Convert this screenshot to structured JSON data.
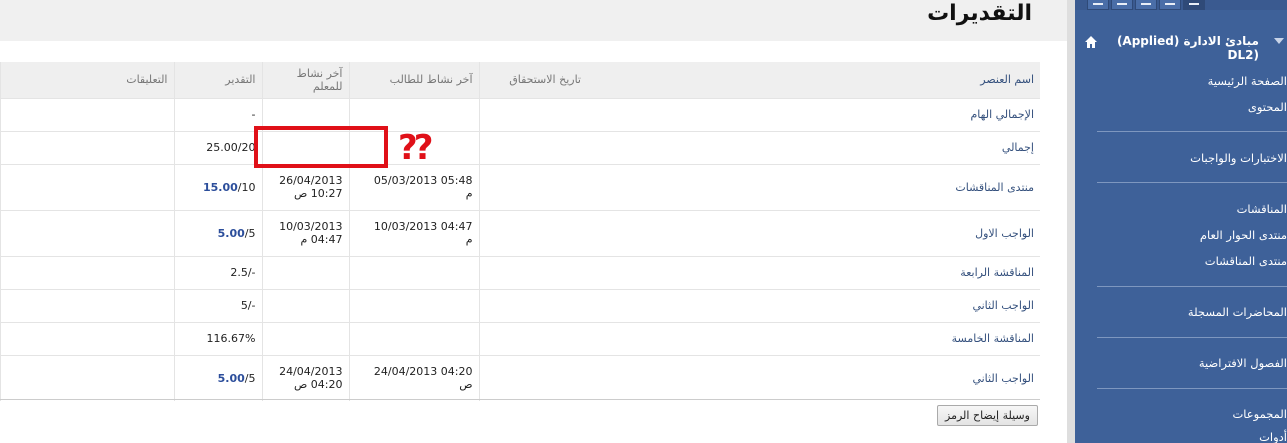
{
  "page": {
    "title": "التقديرات"
  },
  "table": {
    "headers": {
      "item_name": "اسم العنصر",
      "due_date": "تاريخ الاستحقاق",
      "last_student": "آخر نشاط للطالب",
      "last_instructor": "آخر نشاط للمعلم",
      "grade": "التقدير",
      "comments": "التعليقات"
    },
    "rows": [
      {
        "name": "الإجمالي الهام",
        "due": "",
        "student": "",
        "student_suffix": "",
        "instructor": "",
        "instructor_suffix": "",
        "grade_score": "",
        "grade_rest": "-"
      },
      {
        "name": "إجمالي",
        "due": "",
        "student": "",
        "student_suffix": "",
        "instructor": "",
        "instructor_suffix": "",
        "grade_score": "",
        "grade_rest": "25.00/20"
      },
      {
        "name": "منتدى المناقشات",
        "due": "",
        "student": "05/03/2013 05:48",
        "student_suffix": "م",
        "instructor": "26/04/2013 10:27",
        "instructor_suffix": "ص",
        "grade_score": "15.00",
        "grade_rest": "/10"
      },
      {
        "name": "الواجب الاول",
        "due": "",
        "student": "10/03/2013 04:47",
        "student_suffix": "م",
        "instructor": "10/03/2013 04:47",
        "instructor_suffix": "م",
        "grade_score": "5.00",
        "grade_rest": "/5"
      },
      {
        "name": "المناقشة الرابعة",
        "due": "",
        "student": "",
        "student_suffix": "",
        "instructor": "",
        "instructor_suffix": "",
        "grade_score": "",
        "grade_rest": "2.5/-"
      },
      {
        "name": "الواجب الثاني",
        "due": "",
        "student": "",
        "student_suffix": "",
        "instructor": "",
        "instructor_suffix": "",
        "grade_score": "",
        "grade_rest": "5/-"
      },
      {
        "name": "المناقشة الخامسة",
        "due": "",
        "student": "",
        "student_suffix": "",
        "instructor": "",
        "instructor_suffix": "",
        "grade_score": "",
        "grade_rest": "116.67%"
      },
      {
        "name": "الواجب الثاني",
        "due": "",
        "student": "24/04/2013 04:20",
        "student_suffix": "ص",
        "instructor": "24/04/2013 04:20",
        "instructor_suffix": "ص",
        "grade_score": "5.00",
        "grade_rest": "/5"
      }
    ]
  },
  "footer": {
    "legend_button": "وسيلة إيضاح الرمز"
  },
  "annotation": {
    "marks": "??"
  },
  "sidebar": {
    "course_title": "مبادئ الادارة (Applied) (DL2",
    "links": [
      "الصفحة الرئيسية",
      "المحتوى",
      "الاختبارات والواجبات",
      "المناقشات",
      "منتدى الحوار العام",
      "منتدى المناقشات",
      "المحاضرات المسجلة",
      "الفصول الافتراضية",
      "المجموعات",
      "أدوات"
    ]
  },
  "colors": {
    "sidebar_bg": "#3e6199",
    "highlight_red": "#e01018",
    "link_blue": "#34507d"
  }
}
